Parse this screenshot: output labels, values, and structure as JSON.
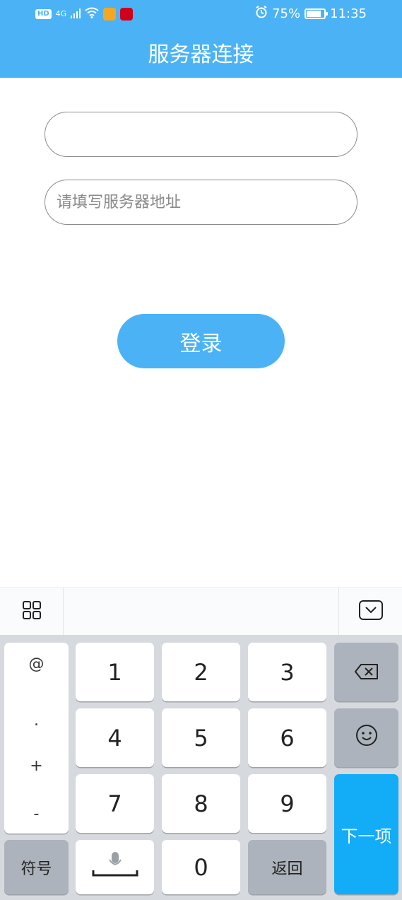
{
  "status_bar": {
    "left_badge": "HD",
    "network": "4G",
    "battery": "75%",
    "battery_level": 0.75,
    "time": "11:35"
  },
  "header": {
    "title": "服务器连接"
  },
  "form": {
    "field1_value": "",
    "field2_placeholder": "请填写服务器地址",
    "login_label": "登录"
  },
  "keyboard": {
    "symbols": [
      "@",
      ".",
      "+",
      "-"
    ],
    "keys": [
      "1",
      "2",
      "3",
      "4",
      "5",
      "6",
      "7",
      "8",
      "9",
      "0"
    ],
    "symbol_key": "符号",
    "return_key": "返回",
    "next_key": "下一项"
  },
  "colors": {
    "accent": "#4bb3f5",
    "next_key": "#13acf6",
    "keyboard_bg": "#d6d9de"
  }
}
